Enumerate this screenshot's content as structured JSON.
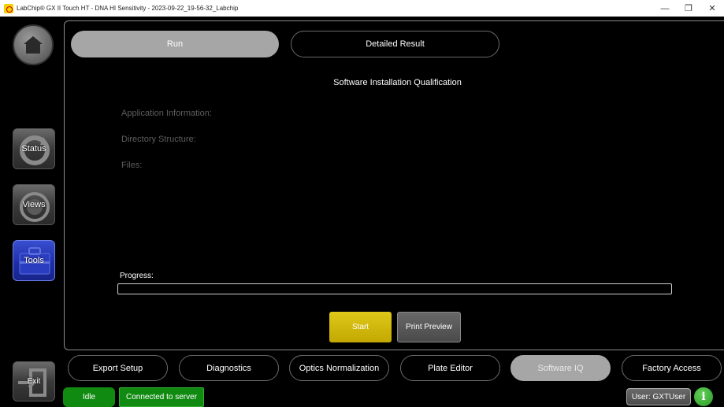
{
  "window": {
    "title": "LabChip® GX II Touch HT - DNA HI Sensitivity - 2023-09-22_19-56-32_Labchip",
    "controls": {
      "minimize": "—",
      "restore": "❐",
      "close": "✕"
    }
  },
  "sidebar": {
    "home_icon": "home-icon",
    "items": [
      {
        "label": "Status",
        "icon": "refresh-icon"
      },
      {
        "label": "Views",
        "icon": "views-icon"
      },
      {
        "label": "Tools",
        "icon": "toolbox-icon",
        "active": true
      }
    ],
    "exit_label": "Exit"
  },
  "tabs": [
    {
      "label": "Run",
      "active": true
    },
    {
      "label": "Detailed Result",
      "active": false
    }
  ],
  "main": {
    "heading": "Software Installation Qualification",
    "info_labels": [
      "Application Information:",
      "Directory Structure:",
      "Files:"
    ],
    "progress_label": "Progress:",
    "progress_value": 0,
    "start_label": "Start",
    "print_preview_label": "Print Preview"
  },
  "bottom_tabs": [
    {
      "label": "Export Setup",
      "active": false
    },
    {
      "label": "Diagnostics",
      "active": false
    },
    {
      "label": "Optics Normalization",
      "active": false
    },
    {
      "label": "Plate Editor",
      "active": false
    },
    {
      "label": "Software IQ",
      "active": true
    },
    {
      "label": "Factory Access",
      "active": false
    }
  ],
  "status": {
    "state": "Idle",
    "connection": "Connected to server",
    "user": "User: GXTUser"
  },
  "colors": {
    "accent_yellow": "#c9b000",
    "status_green": "#118a11",
    "tools_blue": "#1e2fa8",
    "tab_active_gray": "#a6a6a6"
  }
}
